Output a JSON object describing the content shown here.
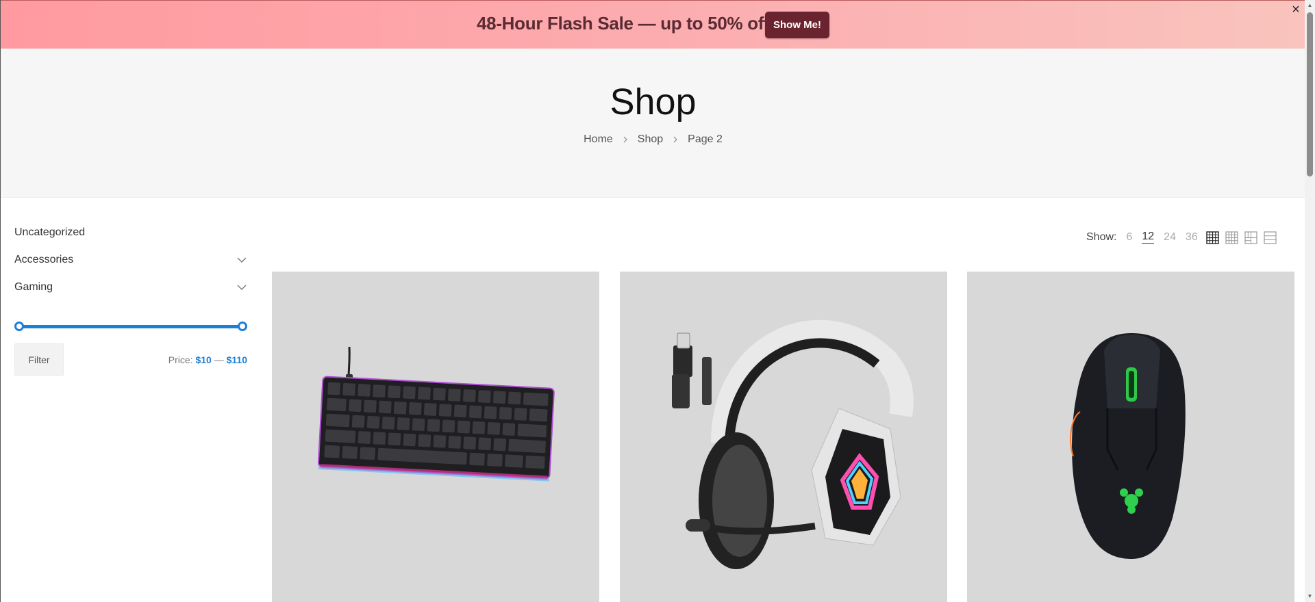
{
  "banner": {
    "text": "48-Hour Flash Sale — up to 50% off",
    "button_label": "Show Me!",
    "close_glyph": "×"
  },
  "hero": {
    "title": "Shop",
    "breadcrumb": [
      "Home",
      "Shop",
      "Page 2"
    ]
  },
  "sidebar": {
    "categories": [
      {
        "label": "Uncategorized",
        "expandable": false
      },
      {
        "label": "Accessories",
        "expandable": true
      },
      {
        "label": "Gaming",
        "expandable": true
      }
    ],
    "price_filter": {
      "button_label": "Filter",
      "price_label": "Price:",
      "min": "$10",
      "separator": "—",
      "max": "$110",
      "range_fraction": [
        0,
        1
      ]
    }
  },
  "toolbar": {
    "show_label": "Show:",
    "show_options": [
      "6",
      "12",
      "24",
      "36"
    ],
    "active_option": "12",
    "view_icons": [
      "grid-2-icon",
      "grid-3-icon",
      "grid-4-icon",
      "list-icon"
    ]
  },
  "products": [
    {
      "image": "keyboard-image"
    },
    {
      "image": "headset-image"
    },
    {
      "image": "mouse-image"
    }
  ],
  "colors": {
    "accent": "#1c7fd6",
    "banner_button": "#6a242f",
    "product_bg": "#d8d8d8"
  }
}
